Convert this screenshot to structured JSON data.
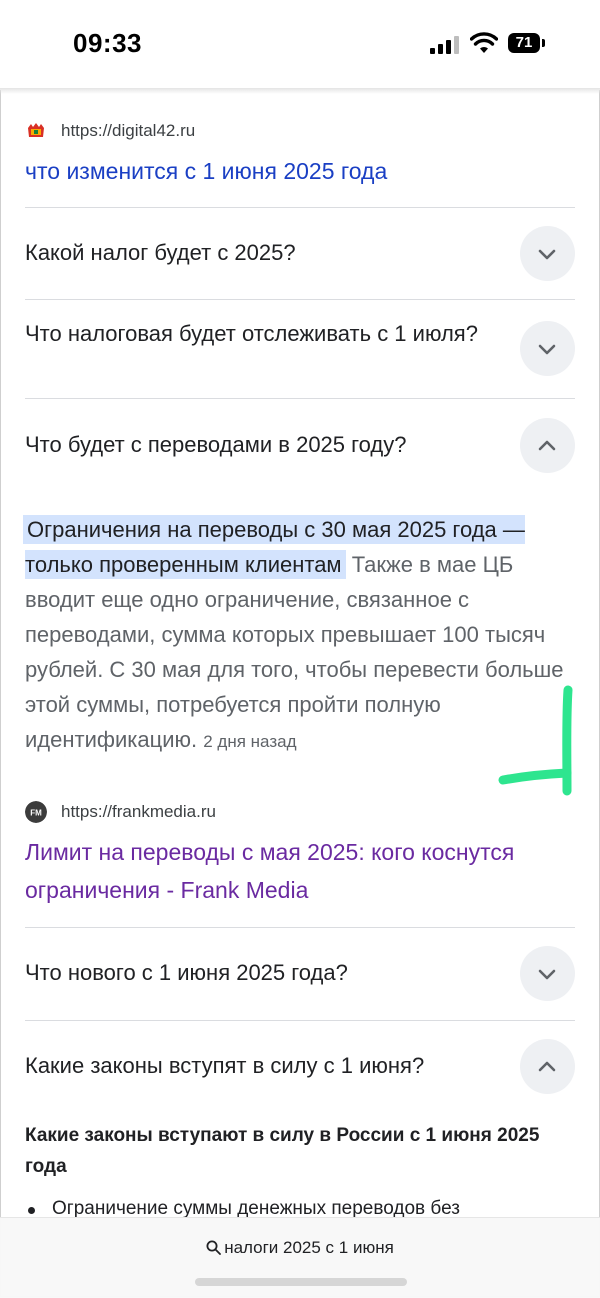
{
  "status_bar": {
    "time": "09:33",
    "battery": "71"
  },
  "result1": {
    "url": "https://digital42.ru",
    "title": "что изменится с 1 июня 2025 года"
  },
  "faq": [
    {
      "question": "Какой налог будет с 2025?",
      "expanded": false
    },
    {
      "question": "Что налоговая будет отслеживать с 1 июля?",
      "expanded": false
    },
    {
      "question": "Что будет с переводами в 2025 году?",
      "expanded": true
    }
  ],
  "answer": {
    "highlight": "Ограничения на переводы с 30 мая 2025 года — только проверенным клиентам",
    "body": "Также в мае ЦБ вводит еще одно ограничение, связанное с переводами, сумма которых превышает 100 тысяч рублей. С 30 мая для того, чтобы перевести больше этой суммы, потребуется пройти полную идентификацию.",
    "date": "2 дня назад"
  },
  "result2": {
    "url": "https://frankmedia.ru",
    "favicon_text": "FM",
    "title": "Лимит на переводы с мая 2025: кого коснутся ограничения - Frank Media"
  },
  "faq2": [
    {
      "question": "Что нового с 1 июня 2025 года?",
      "expanded": false
    },
    {
      "question": "Какие законы вступят в силу с 1 июня?",
      "expanded": true
    }
  ],
  "answer2": {
    "heading": "Какие законы вступают в силу в России с 1 июня 2025 года",
    "bullet": "Ограничение суммы денежных переводов без"
  },
  "search_bar": {
    "query": "налоги 2025 с 1 июня"
  },
  "colors": {
    "link_blue": "#1a3fc4",
    "link_visited": "#6a2aa1",
    "highlight": "#d3e3fd",
    "doodle": "#2ee58f"
  }
}
